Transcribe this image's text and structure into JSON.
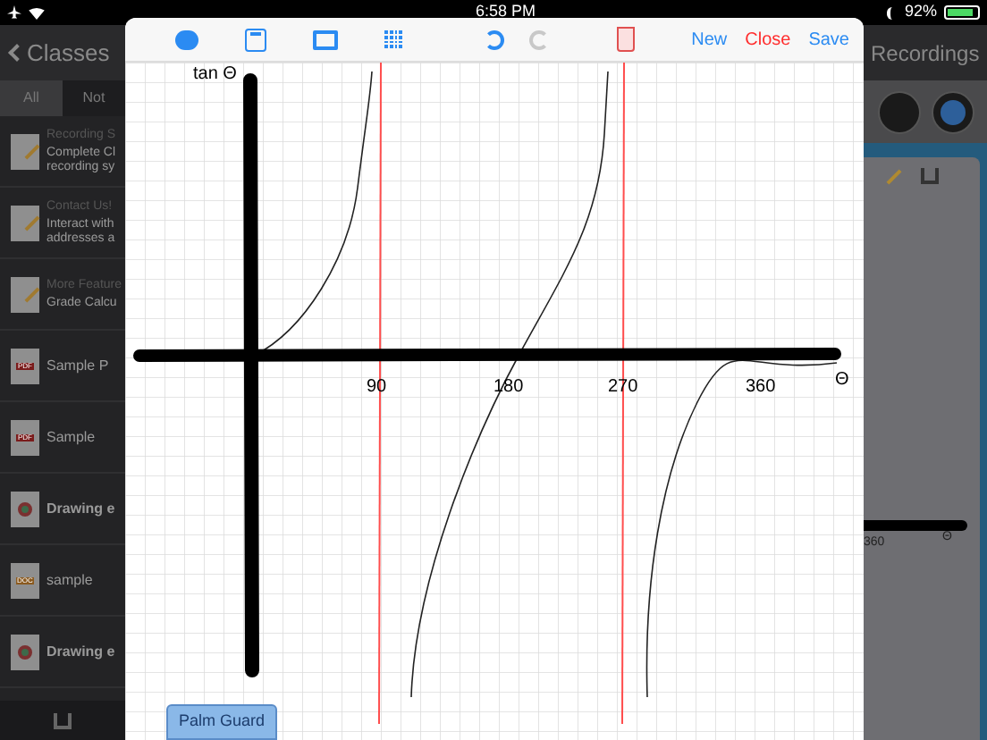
{
  "status_bar": {
    "time": "6:58 PM",
    "battery": "92%"
  },
  "background": {
    "back_label": "Classes",
    "right_title": "Recordings",
    "tabs": [
      {
        "label": "All",
        "selected": true
      },
      {
        "label": "Not",
        "selected": false
      }
    ],
    "items": [
      {
        "kind": "note",
        "title": "Recording S",
        "lines": [
          "Complete Cl",
          "recording sy"
        ]
      },
      {
        "kind": "note",
        "title": "Contact Us!",
        "lines": [
          "Interact with",
          "addresses a"
        ]
      },
      {
        "kind": "note",
        "title": "More Feature",
        "lines": [
          "Grade Calcu"
        ]
      },
      {
        "kind": "pdf",
        "badge": "PDF",
        "title": "Sample P"
      },
      {
        "kind": "pdf",
        "badge": "PDF",
        "title": "Sample"
      },
      {
        "kind": "drawing",
        "title": "Drawing e"
      },
      {
        "kind": "doc",
        "badge": "DOC",
        "title": "sample"
      },
      {
        "kind": "drawing",
        "title": "Drawing e"
      }
    ],
    "preview_labels": [
      "360",
      "Θ"
    ]
  },
  "drawing": {
    "toolbar": {
      "actions": [
        {
          "label": "New",
          "kind": "normal"
        },
        {
          "label": "Close",
          "kind": "destructive"
        },
        {
          "label": "Save",
          "kind": "normal"
        }
      ],
      "redo_disabled": true
    },
    "labels": [
      {
        "text": "tan Θ"
      },
      {
        "text": "90"
      },
      {
        "text": "180"
      },
      {
        "text": "270"
      },
      {
        "text": "360"
      },
      {
        "text": "Θ"
      }
    ],
    "palm_guard": "Palm Guard"
  }
}
